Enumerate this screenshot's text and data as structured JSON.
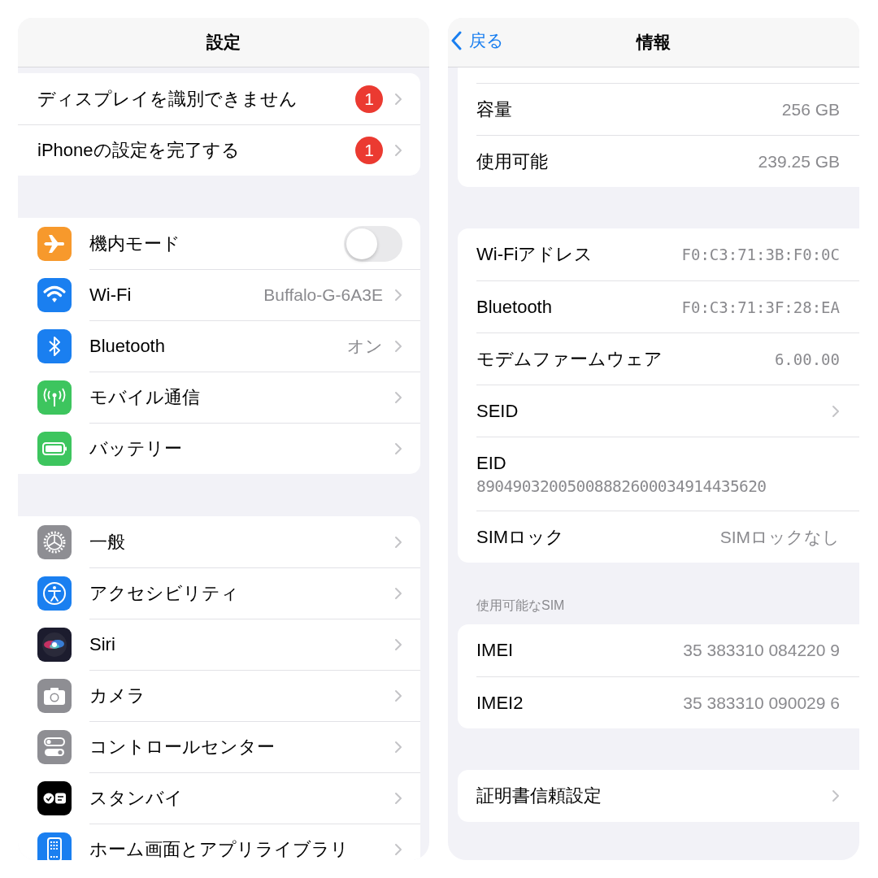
{
  "settings": {
    "title": "設定",
    "groups": [
      {
        "rows": [
          {
            "label": "ディスプレイを識別できません",
            "badge": "1",
            "kind": "link"
          },
          {
            "label": "iPhoneの設定を完了する",
            "badge": "1",
            "kind": "link"
          }
        ]
      },
      {
        "rows": [
          {
            "color": "#f7992c",
            "label": "機内モード",
            "kind": "toggle",
            "on": false
          },
          {
            "color": "#1a7ff0",
            "label": "Wi-Fi",
            "value": "Buffalo-G-6A3E",
            "kind": "link"
          },
          {
            "color": "#1a7ff0",
            "label": "Bluetooth",
            "value": "オン",
            "kind": "link"
          },
          {
            "color": "#3dc55e",
            "label": "モバイル通信",
            "kind": "link"
          },
          {
            "color": "#3dc55e",
            "label": "バッテリー",
            "kind": "link"
          }
        ]
      },
      {
        "rows": [
          {
            "color": "#8e8e93",
            "label": "一般",
            "kind": "link"
          },
          {
            "color": "#1a7ff0",
            "label": "アクセシビリティ",
            "kind": "link"
          },
          {
            "color": "#1c1c2e",
            "label": "Siri",
            "kind": "link"
          },
          {
            "color": "#8e8e93",
            "label": "カメラ",
            "kind": "link"
          },
          {
            "color": "#8e8e93",
            "label": "コントロールセンター",
            "kind": "link"
          },
          {
            "color": "#000000",
            "label": "スタンバイ",
            "kind": "link"
          },
          {
            "color": "#1a7ff0",
            "label": "ホーム画面とアプリライブラリ",
            "kind": "link"
          }
        ]
      }
    ]
  },
  "about": {
    "back": "戻る",
    "title": "情報",
    "groups": [
      {
        "rows": [
          {
            "label": "容量",
            "value": "256 GB",
            "kind": "info"
          },
          {
            "label": "使用可能",
            "value": "239.25 GB",
            "kind": "info"
          }
        ]
      },
      {
        "rows": [
          {
            "label": "Wi-Fiアドレス",
            "value": "F0:C3:71:3B:F0:0C",
            "kind": "mono"
          },
          {
            "label": "Bluetooth",
            "value": "F0:C3:71:3F:28:EA",
            "kind": "mono"
          },
          {
            "label": "モデムファームウェア",
            "value": "6.00.00",
            "kind": "mono"
          },
          {
            "label": "SEID",
            "kind": "link"
          },
          {
            "label": "EID",
            "value": "89049032005008882600034914435620",
            "kind": "stacked"
          },
          {
            "label": "SIMロック",
            "value": "SIMロックなし",
            "kind": "info"
          }
        ]
      },
      {
        "header": "使用可能なSIM",
        "rows": [
          {
            "label": "IMEI",
            "value": "35 383310 084220 9",
            "kind": "info"
          },
          {
            "label": "IMEI2",
            "value": "35 383310 090029 6",
            "kind": "info"
          }
        ]
      },
      {
        "rows": [
          {
            "label": "証明書信頼設定",
            "kind": "link"
          }
        ]
      }
    ]
  }
}
